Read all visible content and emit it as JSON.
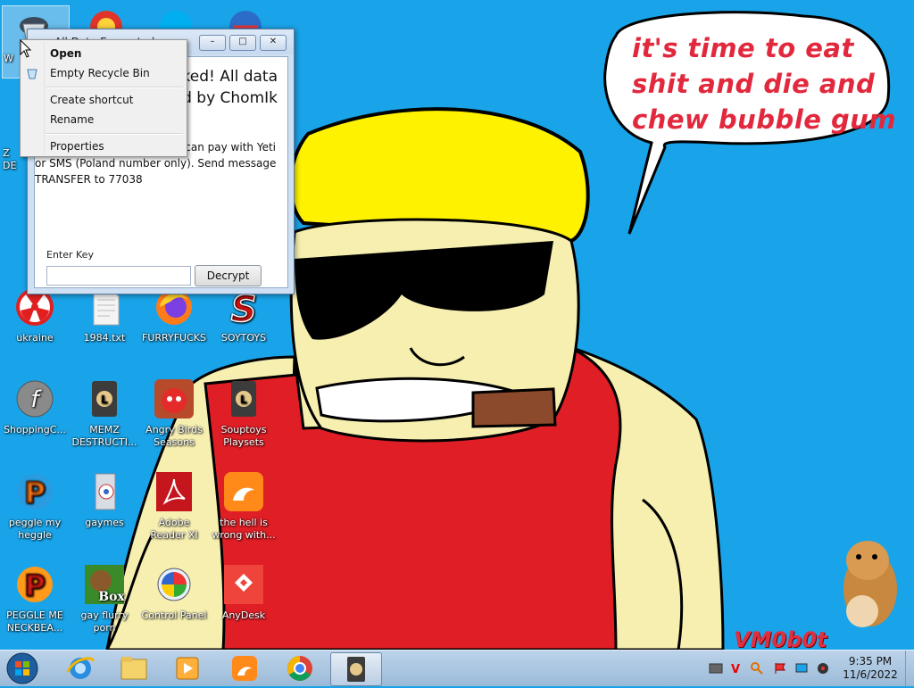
{
  "wallpaper": {
    "speech_bubble": "it's time to eat shit and die and chew bubble gum",
    "signature": "VM0b0t"
  },
  "desktop_icons": [
    {
      "label": "ukraine",
      "icon": "radiation-icon"
    },
    {
      "label": "1984.txt",
      "icon": "text-file-icon"
    },
    {
      "label": "FURRYFUCKS",
      "icon": "firefox-icon"
    },
    {
      "label": "SOYTOYS",
      "icon": "soytoys-icon"
    },
    {
      "label": "ShoppingC...",
      "icon": "flash-icon"
    },
    {
      "label": "MEMZ DESTRUCTI...",
      "icon": "memz-icon"
    },
    {
      "label": "Angry Birds Seasons",
      "icon": "angry-birds-icon"
    },
    {
      "label": "Souptoys Playsets",
      "icon": "souptoys-icon"
    },
    {
      "label": "peggle my heggle",
      "icon": "peggle-icon"
    },
    {
      "label": "gaymes",
      "icon": "games-folder-icon"
    },
    {
      "label": "Adobe Reader XI",
      "icon": "adobe-reader-icon"
    },
    {
      "label": "the hell is wrong with...",
      "icon": "uc-browser-icon"
    },
    {
      "label": "PEGGLE ME NECKBEA...",
      "icon": "peggle-icon"
    },
    {
      "label": "gay flurry porn",
      "icon": "bonzi-box-icon"
    },
    {
      "label": "Control Panel",
      "icon": "control-panel-icon"
    },
    {
      "label": "AnyDesk",
      "icon": "anydesk-icon"
    }
  ],
  "partial_icon_labels": {
    "recycle_bin": "W",
    "row2a": "Z",
    "row2b": "DE"
  },
  "window": {
    "title": "All Data Encrypted",
    "message_lines": [
      "cked! All data",
      "ted by ChomIk"
    ],
    "instructions": [
      "can pay with Yeti",
      "or SMS (Poland number only). Send message",
      "TRANSFER to 77038"
    ],
    "enter_key_label": "Enter Key",
    "key_value": "",
    "decrypt_label": "Decrypt"
  },
  "context_menu": {
    "items": [
      {
        "label": "Open",
        "bold": true
      },
      {
        "label": "Empty Recycle Bin",
        "bold": false
      },
      {
        "label": "Create shortcut",
        "bold": false
      },
      {
        "label": "Rename",
        "bold": false
      },
      {
        "label": "Properties",
        "bold": false
      }
    ]
  },
  "taskbar": {
    "pinned": [
      "start-orb-icon",
      "internet-explorer-icon",
      "file-explorer-icon",
      "media-player-icon",
      "uc-browser-icon",
      "chrome-icon",
      "memz-icon"
    ],
    "clock_time": "9:35 PM",
    "clock_date": "11/6/2022"
  },
  "colors": {
    "desktop_bg": "#19a4e9",
    "bubble_text": "#e2283d",
    "taskbar": "#a9c4e0"
  }
}
